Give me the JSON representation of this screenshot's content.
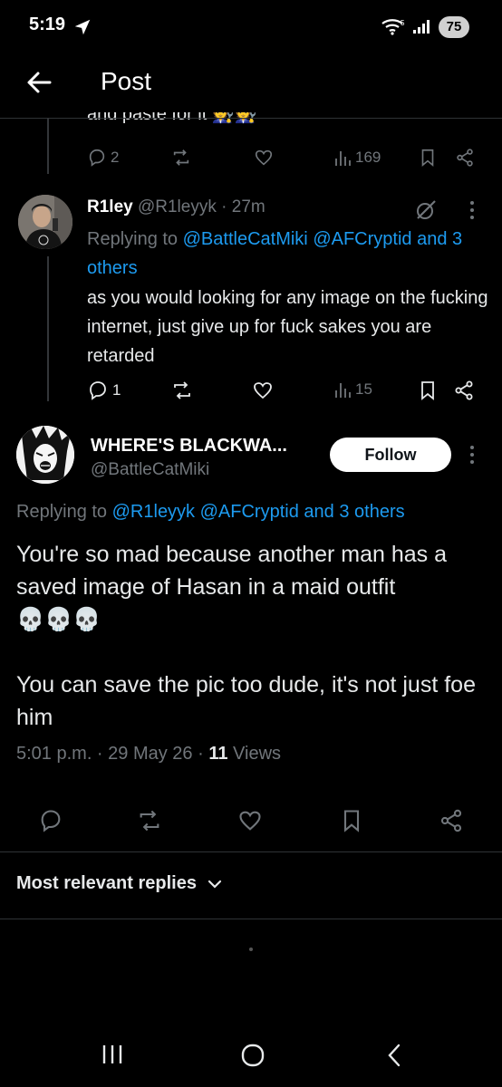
{
  "status_bar": {
    "time": "5:19",
    "battery": "75"
  },
  "header": {
    "title": "Post"
  },
  "partial_post": {
    "text_tail": "and paste for it",
    "emoji": "🧑‍🔧🧑‍🔧",
    "replies": "2",
    "views": "169"
  },
  "reply": {
    "name": "R1ley",
    "handle": "@R1leyyk",
    "time": "· 27m",
    "replying_prefix": "Replying to",
    "replying_to_1": "@BattleCatMiki",
    "replying_to_2": "@AFCryptid",
    "replying_others": "and 3 others",
    "text": "as you would looking for any image on the fucking internet, just give up for fuck sakes you are retarded",
    "replies": "1",
    "views": "15"
  },
  "main_post": {
    "name": "WHERE'S BLACKWA...",
    "handle": "@BattleCatMiki",
    "follow_label": "Follow",
    "replying_prefix": "Replying to",
    "replying_to_1": "@R1leyyk",
    "replying_to_2": "@AFCryptid",
    "replying_others": "and 3 others",
    "text_1": "You're so mad because another man has a saved image of Hasan in a maid outfit",
    "skulls": "💀💀💀",
    "text_2": "You can save the pic too dude, it's not just foe him",
    "timestamp": "5:01 p.m. · 29 May 26 ·",
    "views_count": "11",
    "views_label": "Views"
  },
  "sort": {
    "label": "Most relevant replies"
  },
  "colors": {
    "accent": "#1d9bf0",
    "muted": "#71767b",
    "background": "#000000"
  }
}
